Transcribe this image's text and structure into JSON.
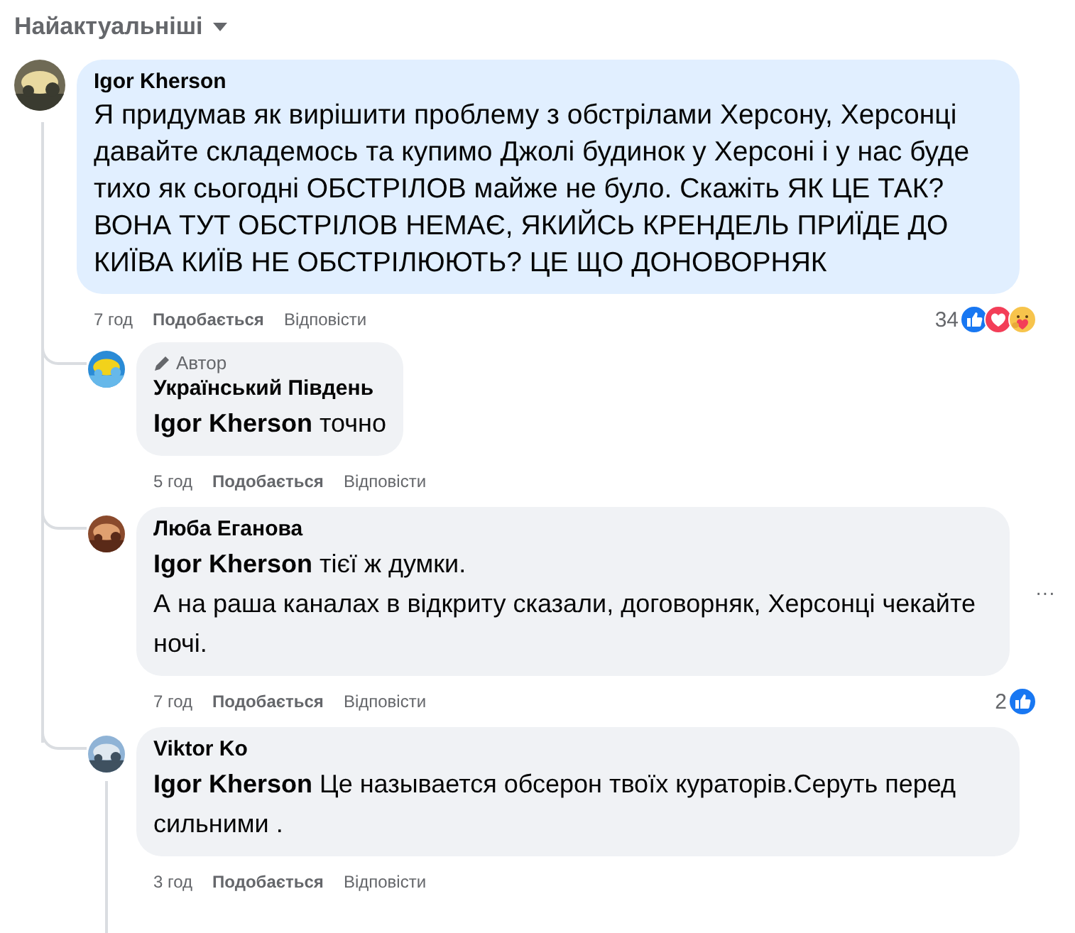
{
  "sort": {
    "label": "Найактуальніші"
  },
  "comments": [
    {
      "author": "Igor Kherson",
      "highlighted": true,
      "text": "Я придумав як вирішити проблему з обстрілами Херсону, Херсонці давайте складемось та купимо Джолі будинок у Херсоні і у нас буде тихо як сьогодні ОБСТРІЛОВ майже не було. Скажіть ЯК ЦЕ ТАК? ВОНА ТУТ ОБСТРІЛОВ НЕМАЄ, ЯКИЙСЬ КРЕНДЕЛЬ ПРИЇДЕ ДО КИЇВА КИЇВ НЕ ОБСТРІЛЮЮТЬ? ЦЕ ЩО ДОНОВОРНЯК",
      "time": "7 год",
      "like": "Подобається",
      "reply": "Відповісти",
      "reactions": {
        "count": "34",
        "icons": [
          {
            "kind": "like"
          },
          {
            "kind": "love"
          },
          {
            "kind": "care"
          }
        ]
      },
      "children": [
        {
          "author": "Український Південь",
          "badge": "Автор",
          "highlighted": false,
          "text": "**Igor Kherson** точно",
          "time": "5 год",
          "like": "Подобається",
          "reply": "Відповісти",
          "thread": false
        },
        {
          "author": "Люба Еганова",
          "highlighted": false,
          "text": "**Igor Kherson** тієї ж думки.\nА на раша каналах в відкриту сказали, договорняк, Херсонці чекайте ночі.",
          "time": "7 год",
          "like": "Подобається",
          "reply": "Відповісти",
          "reactions": {
            "count": "2",
            "icons": [
              {
                "kind": "like"
              }
            ]
          },
          "menu": "···",
          "thread": false
        },
        {
          "author": "Viktor Ko",
          "highlighted": false,
          "text": "**Igor Kherson** Це называется обсерон твоїх кураторів.Серуть перед сильними .",
          "time": "3 год",
          "like": "Подобається",
          "reply": "Відповісти",
          "thread": true
        }
      ]
    }
  ]
}
